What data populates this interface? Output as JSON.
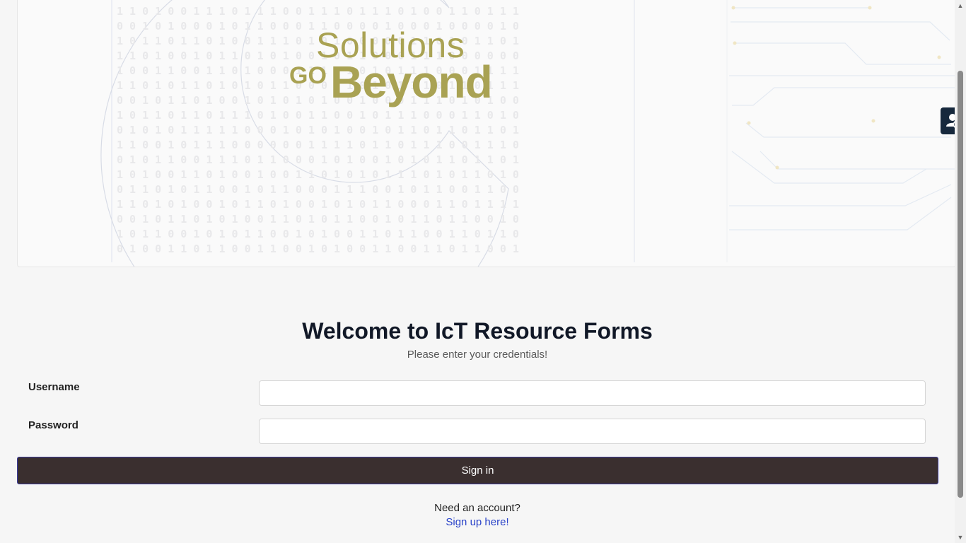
{
  "banner": {
    "logo_line1": "Solutions",
    "logo_go": "GO",
    "logo_line2": "Beyond"
  },
  "login": {
    "title": "Welcome to IcT Resource Forms",
    "subtitle": "Please enter your credentials!",
    "username_label": "Username",
    "username_value": "",
    "password_label": "Password",
    "password_value": "",
    "signin_label": "Sign in",
    "need_account": "Need an account?",
    "signup_link": "Sign up here!"
  },
  "side_tab": {
    "icon": "user-sync-icon"
  },
  "colors": {
    "accent_olive": "#a9a253",
    "button_bg": "#3a2f2f",
    "link": "#2a43c9",
    "side_tab": "#16283c"
  }
}
